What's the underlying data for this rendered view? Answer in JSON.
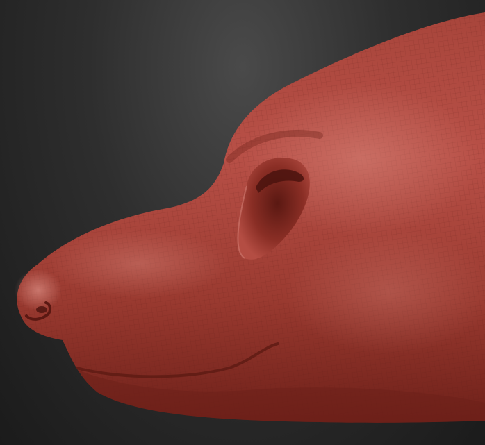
{
  "viewport": {
    "background": "#2a2a2a",
    "model": {
      "subject": "sculpted-animal-head-side-view",
      "material_color": "#b0473c",
      "material_shadow": "#6e2019",
      "material_highlight": "#d8867b",
      "wireframe": true
    }
  }
}
